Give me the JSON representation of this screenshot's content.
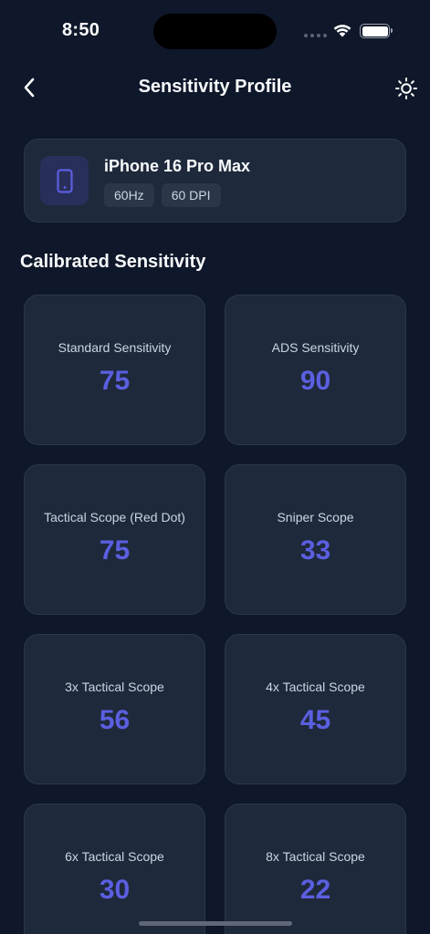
{
  "status_bar": {
    "time": "8:50"
  },
  "header": {
    "title": "Sensitivity Profile"
  },
  "device": {
    "name": "iPhone 16 Pro Max",
    "refresh_rate": "60Hz",
    "dpi": "60 DPI"
  },
  "section": {
    "title": "Calibrated Sensitivity"
  },
  "sensitivities": [
    {
      "label": "Standard Sensitivity",
      "value": "75"
    },
    {
      "label": "ADS Sensitivity",
      "value": "90"
    },
    {
      "label": "Tactical Scope (Red Dot)",
      "value": "75"
    },
    {
      "label": "Sniper Scope",
      "value": "33"
    },
    {
      "label": "3x Tactical Scope",
      "value": "56"
    },
    {
      "label": "4x Tactical Scope",
      "value": "45"
    },
    {
      "label": "6x Tactical Scope",
      "value": "30"
    },
    {
      "label": "8x Tactical Scope",
      "value": "22"
    }
  ],
  "colors": {
    "background": "#0f172a",
    "card": "#1e293b",
    "accent": "#5b5fe0"
  },
  "icons": {
    "back": "chevron-left-icon",
    "theme": "sun-icon",
    "device": "phone-icon"
  }
}
